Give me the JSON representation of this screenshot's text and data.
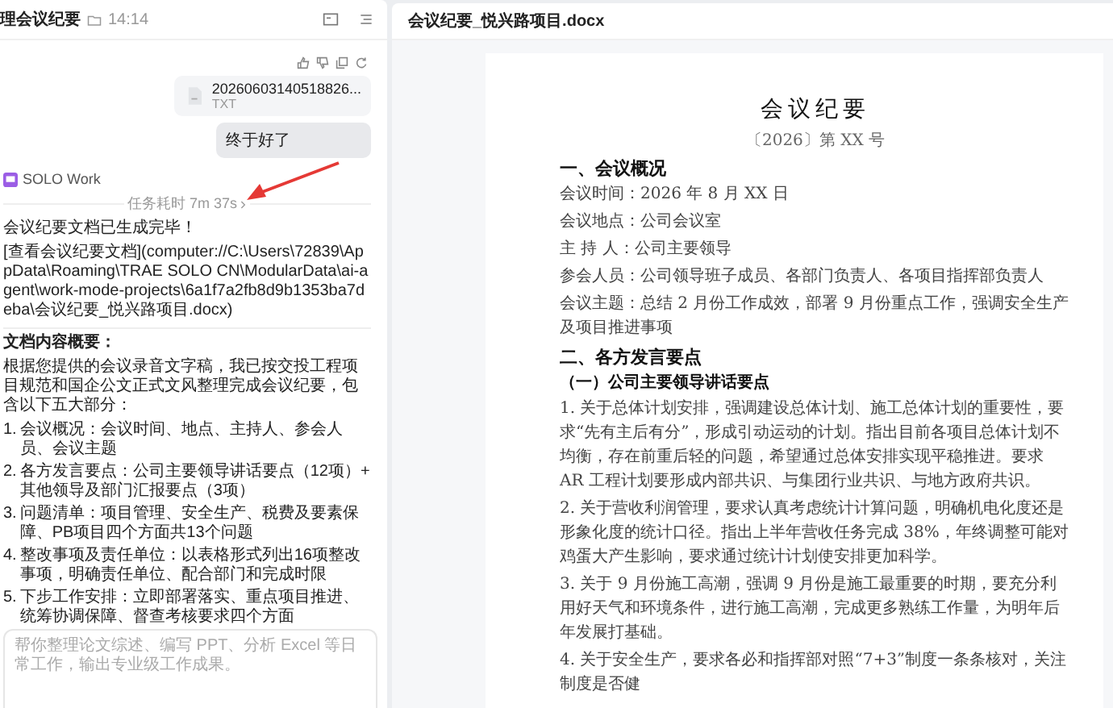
{
  "chat": {
    "title": "理会议纪要",
    "time": "14:14",
    "attachment": {
      "name": "20260603140518826...",
      "type": "TXT"
    },
    "user_message": "终于好了",
    "agent_name": "SOLO Work",
    "duration": "任务耗时 7m 37s",
    "reply": {
      "done": "会议纪要文档已生成完毕！",
      "link": "[查看会议纪要文档](computer://C:\\Users\\72839\\AppData\\Roaming\\TRAE SOLO CN\\ModularData\\ai-agent\\work-mode-projects\\6a1f7a2fb8d9b1353ba7deba\\会议纪要_悦兴路项目.docx)",
      "summary_heading": "文档内容概要：",
      "intro": "根据您提供的会议录音文字稿，我已按交投工程项目规范和国企公文正式文风整理完成会议纪要，包含以下五大部分：",
      "items": [
        {
          "num": "1.",
          "text": "会议概况：会议时间、地点、主持人、参会人员、会议主题"
        },
        {
          "num": "2.",
          "text": "各方发言要点：公司主要领导讲话要点（12项）+ 其他领导及部门汇报要点（3项）"
        },
        {
          "num": "3.",
          "text": "问题清单：项目管理、安全生产、税费及要素保障、PB项目四个方面共13个问题"
        },
        {
          "num": "4.",
          "text": "整改事项及责任单位：以表格形式列出16项整改事项，明确责任单位、配合部门和完成时限"
        },
        {
          "num": "5.",
          "text": "下步工作安排：立即部署落实、重点项目推进、统筹协调保障、督查考核要求四个方面"
        }
      ]
    },
    "input": {
      "placeholder": "帮你整理论文综述、编写 PPT、分析 Excel 等日常工作，输出专业级工作成果。"
    }
  },
  "document": {
    "filename": "会议纪要_悦兴路项目.docx",
    "title": "会议纪要",
    "number": "〔2026〕第 XX 号",
    "blocks": [
      {
        "kind": "h1",
        "text": "一、会议概况"
      },
      {
        "kind": "p",
        "text": "会议时间：2026 年 8 月 XX 日"
      },
      {
        "kind": "p",
        "text": "会议地点：公司会议室"
      },
      {
        "kind": "p",
        "text": "主 持 人：公司主要领导"
      },
      {
        "kind": "p",
        "text": "参会人员：公司领导班子成员、各部门负责人、各项目指挥部负责人"
      },
      {
        "kind": "p",
        "text": "会议主题：总结 2 月份工作成效，部署 9 月份重点工作，强调安全生产及项目推进事项"
      },
      {
        "kind": "h1",
        "text": "二、各方发言要点"
      },
      {
        "kind": "h2",
        "text": "（一）公司主要领导讲话要点"
      },
      {
        "kind": "p",
        "text": "1. 关于总体计划安排，强调建设总体计划、施工总体计划的重要性，要求“先有主后有分”，形成引动运动的计划。指出目前各项目总体计划不均衡，存在前重后轻的问题，希望通过总体安排实现平稳推进。要求 AR 工程计划要形成内部共识、与集团行业共识、与地方政府共识。"
      },
      {
        "kind": "p",
        "text": "2. 关于营收利润管理，要求认真考虑统计计算问题，明确机电化度还是形象化度的统计口径。指出上半年营收任务完成 38%，年终调整可能对鸡蛋大产生影响，要求通过统计计划使安排更加科学。"
      },
      {
        "kind": "p",
        "text": "3. 关于 9 月份施工高潮，强调 9 月份是施工最重要的时期，要充分利用好天气和环境条件，进行施工高潮，完成更多熟练工作量，为明年后年发展打基础。"
      },
      {
        "kind": "p",
        "text": "4. 关于安全生产，要求各必和指挥部对照“7+3”制度一条条核对，关注制度是否健"
      }
    ]
  }
}
